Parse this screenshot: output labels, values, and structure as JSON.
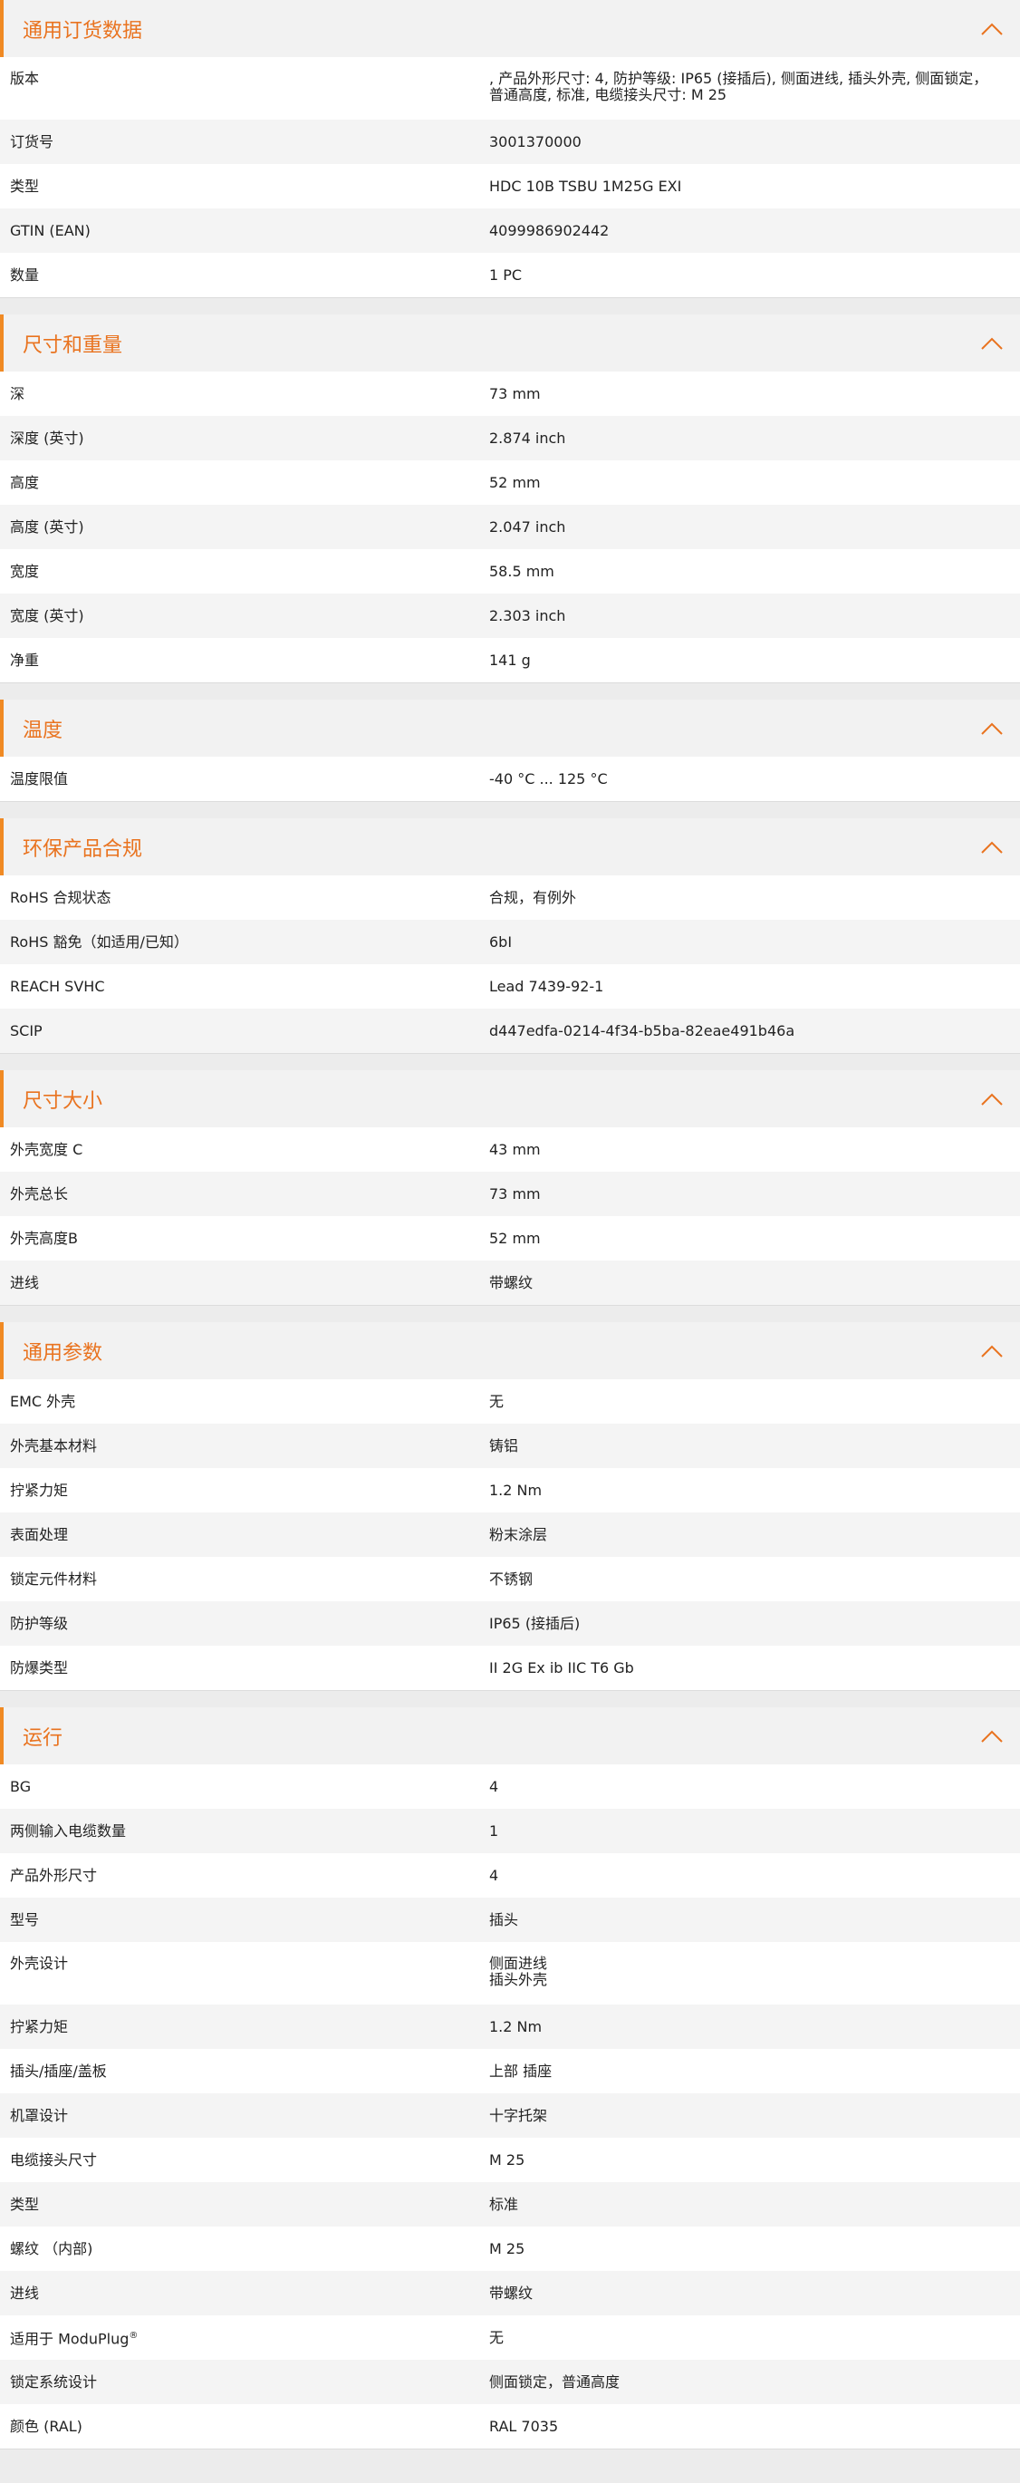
{
  "accent_color": "#e9731f",
  "sections": [
    {
      "title": "通用订货数据",
      "icon": "chevron-up-icon",
      "rows": [
        {
          "label": "版本",
          "value": ", 产品外形尺寸: 4, 防护等级: IP65 (接插后), 侧面进线, 插头外壳, 侧面锁定，普通高度, 标准, 电缆接头尺寸: M 25",
          "tall": true
        },
        {
          "label": "订货号",
          "value": "3001370000"
        },
        {
          "label": "类型",
          "value": "HDC 10B TSBU 1M25G EXI"
        },
        {
          "label": "GTIN (EAN)",
          "value": "4099986902442"
        },
        {
          "label": "数量",
          "value": "1  PC"
        }
      ]
    },
    {
      "title": "尺寸和重量",
      "icon": "chevron-up-icon",
      "rows": [
        {
          "label": "深",
          "value": "73  mm"
        },
        {
          "label": "深度 (英寸)",
          "value": "2.874  inch"
        },
        {
          "label": "高度",
          "value": "52  mm"
        },
        {
          "label": "高度 (英寸)",
          "value": "2.047  inch"
        },
        {
          "label": "宽度",
          "value": "58.5  mm"
        },
        {
          "label": "宽度 (英寸)",
          "value": "2.303  inch"
        },
        {
          "label": "净重",
          "value": "141  g"
        }
      ]
    },
    {
      "title": "温度",
      "icon": "chevron-up-icon",
      "rows": [
        {
          "label": "温度限值",
          "value": "-40 °C ... 125 °C"
        }
      ]
    },
    {
      "title": "环保产品合规",
      "icon": "chevron-up-icon",
      "rows": [
        {
          "label": "RoHS 合规状态",
          "value": "合规，有例外"
        },
        {
          "label": "RoHS 豁免（如适用/已知）",
          "value": "6bI"
        },
        {
          "label": "REACH SVHC",
          "value": "Lead 7439-92-1"
        },
        {
          "label": "SCIP",
          "value": "d447edfa-0214-4f34-b5ba-82eae491b46a"
        }
      ]
    },
    {
      "title": "尺寸大小",
      "icon": "chevron-up-icon",
      "rows": [
        {
          "label": "外壳宽度 C",
          "value": "43  mm"
        },
        {
          "label": "外壳总长",
          "value": "73  mm"
        },
        {
          "label": "外壳高度B",
          "value": "52  mm"
        },
        {
          "label": "进线",
          "value": "带螺纹"
        }
      ]
    },
    {
      "title": "通用参数",
      "icon": "chevron-up-icon",
      "rows": [
        {
          "label": "EMC 外壳",
          "value": "无"
        },
        {
          "label": "外壳基本材料",
          "value": "铸铝"
        },
        {
          "label": "拧紧力矩",
          "value": "1.2  Nm"
        },
        {
          "label": "表面处理",
          "value": "粉末涂层"
        },
        {
          "label": "锁定元件材料",
          "value": "不锈钢"
        },
        {
          "label": "防护等级",
          "value": "IP65 (接插后)"
        },
        {
          "label": "防爆类型",
          "value": "II 2G Ex ib IIC T6 Gb"
        }
      ]
    },
    {
      "title": "运行",
      "icon": "chevron-up-icon",
      "rows": [
        {
          "label": "BG",
          "value": "4"
        },
        {
          "label": "两侧输入电缆数量",
          "value": "1"
        },
        {
          "label": "产品外形尺寸",
          "value": "4"
        },
        {
          "label": "型号",
          "value": "插头"
        },
        {
          "label": "外壳设计",
          "value": "侧面进线\n插头外壳",
          "tall": true
        },
        {
          "label": "拧紧力矩",
          "value": "1.2  Nm"
        },
        {
          "label": "插头/插座/盖板",
          "value": "上部 插座"
        },
        {
          "label": "机罩设计",
          "value": "十字托架"
        },
        {
          "label": "电缆接头尺寸",
          "value": "M 25"
        },
        {
          "label": "类型",
          "value": "标准"
        },
        {
          "label": "螺纹 （内部)",
          "value": "M 25"
        },
        {
          "label": "进线",
          "value": "带螺纹"
        },
        {
          "label": "适用于 ModuPlug",
          "label_sup": "®",
          "value": "无"
        },
        {
          "label": "锁定系统设计",
          "value": "侧面锁定，普通高度"
        },
        {
          "label": "颜色 (RAL)",
          "value": "RAL 7035"
        }
      ]
    }
  ]
}
